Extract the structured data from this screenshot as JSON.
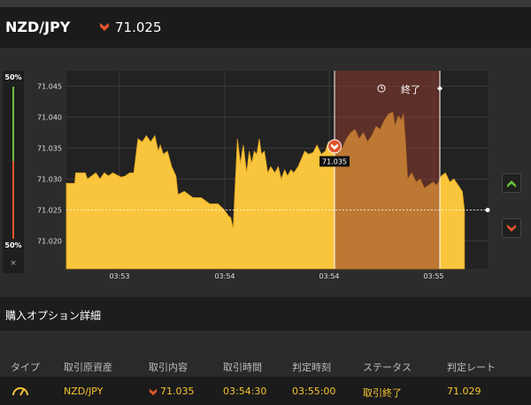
{
  "header": {
    "pair": "NZD/JPY",
    "rate": "71.025",
    "rate_direction_icon": "down-arrow-icon"
  },
  "gauge": {
    "top_label": "50%",
    "bottom_label": "50%",
    "close_glyph": "×"
  },
  "chart_data": {
    "type": "area",
    "yticks": [
      "71.045",
      "71.040",
      "71.035",
      "71.030",
      "71.025",
      "71.020"
    ],
    "ylim": [
      71.0155,
      71.0475
    ],
    "xticks": [
      "03:53",
      "03:54",
      "03:54",
      "03:55"
    ],
    "series": [
      {
        "color": "#f9c53c",
        "points": [
          [
            0,
            71.0293
          ],
          [
            2,
            71.0293
          ],
          [
            2.2,
            71.031
          ],
          [
            4.5,
            71.031
          ],
          [
            5,
            71.03
          ],
          [
            6,
            71.0305
          ],
          [
            7,
            71.031
          ],
          [
            8,
            71.03
          ],
          [
            9,
            71.031
          ],
          [
            10,
            71.0305
          ],
          [
            11,
            71.031
          ],
          [
            13,
            71.0303
          ],
          [
            14,
            71.0305
          ],
          [
            15,
            71.031
          ],
          [
            16,
            71.031
          ],
          [
            17,
            71.0365
          ],
          [
            18,
            71.036
          ],
          [
            19,
            71.037
          ],
          [
            20,
            71.036
          ],
          [
            21,
            71.037
          ],
          [
            21.8,
            71.0345
          ],
          [
            22.3,
            71.0355
          ],
          [
            23,
            71.034
          ],
          [
            24,
            71.0345
          ],
          [
            25,
            71.032
          ],
          [
            26,
            71.0305
          ],
          [
            26.5,
            71.0275
          ],
          [
            28,
            71.028
          ],
          [
            30,
            71.027
          ],
          [
            32,
            71.027
          ],
          [
            34,
            71.026
          ],
          [
            36,
            71.026
          ],
          [
            37.5,
            71.025
          ],
          [
            38.5,
            71.024
          ],
          [
            39,
            71.0238
          ],
          [
            39.6,
            71.022
          ],
          [
            40,
            71.028
          ],
          [
            40.6,
            71.0365
          ],
          [
            41.3,
            71.0325
          ],
          [
            42,
            71.0355
          ],
          [
            42.8,
            71.031
          ],
          [
            43.4,
            71.0345
          ],
          [
            44,
            71.0325
          ],
          [
            44.6,
            71.0345
          ],
          [
            45.2,
            71.034
          ],
          [
            45.8,
            71.0365
          ],
          [
            46.3,
            71.034
          ],
          [
            47,
            71.0345
          ],
          [
            47.8,
            71.031
          ],
          [
            48.5,
            71.032
          ],
          [
            49.5,
            71.031
          ],
          [
            50.3,
            71.032
          ],
          [
            51,
            71.03
          ],
          [
            51.8,
            71.0315
          ],
          [
            52.5,
            71.0305
          ],
          [
            53.3,
            71.0315
          ],
          [
            54,
            71.031
          ],
          [
            55,
            71.032
          ],
          [
            56.6,
            71.0345
          ],
          [
            57.5,
            71.034
          ],
          [
            58.6,
            71.0343
          ],
          [
            59.5,
            71.0355
          ],
          [
            60.5,
            71.034
          ],
          [
            61.5,
            71.0345
          ],
          [
            62.2,
            71.036
          ],
          [
            63.5,
            71.036
          ],
          [
            64.5,
            71.0345
          ],
          [
            65.5,
            71.035
          ],
          [
            66.5,
            71.0365
          ],
          [
            67.5,
            71.0375
          ],
          [
            68.5,
            71.038
          ],
          [
            69.5,
            71.0365
          ],
          [
            70.5,
            71.0375
          ],
          [
            71.5,
            71.036
          ],
          [
            72.5,
            71.037
          ],
          [
            73.5,
            71.0385
          ],
          [
            74.5,
            71.038
          ],
          [
            75.5,
            71.0395
          ],
          [
            76.5,
            71.0405
          ],
          [
            77.5,
            71.0408
          ],
          [
            78,
            71.0385
          ],
          [
            78.8,
            71.0402
          ],
          [
            79.5,
            71.0395
          ],
          [
            80,
            71.0405
          ],
          [
            80.5,
            71.036
          ],
          [
            81,
            71.03
          ],
          [
            82,
            71.031
          ],
          [
            83,
            71.0295
          ],
          [
            84,
            71.03
          ],
          [
            85,
            71.0285
          ],
          [
            86,
            71.029
          ],
          [
            87,
            71.0295
          ],
          [
            88,
            71.029
          ],
          [
            89,
            71.0305
          ],
          [
            90,
            71.031
          ],
          [
            91,
            71.0295
          ],
          [
            92,
            71.03
          ],
          [
            93,
            71.029
          ],
          [
            94,
            71.028
          ],
          [
            94.5,
            71.025
          ]
        ]
      }
    ],
    "current_price": 71.025,
    "entry_price": 71.035,
    "entry_label": "71.035",
    "end_label": "終了"
  },
  "section": {
    "title": "購入オプション詳細"
  },
  "table": {
    "columns": [
      "タイプ",
      "取引原資産",
      "取引内容",
      "取引時間",
      "判定時刻",
      "ステータス",
      "判定レート"
    ],
    "row": {
      "type_icon": "gauge-icon",
      "asset": "NZD/JPY",
      "direction_icon": "down-arrow-icon",
      "content": "71.035",
      "trade_time": "03:54:30",
      "judge_time": "03:55:00",
      "status": "取引終了",
      "judge_rate": "71.029"
    }
  },
  "colors": {
    "area": "#f9c53c",
    "down": "#e0552d",
    "up": "#6bbf3a",
    "end_zone": "#8c3a2e",
    "accent_text": "#f5c431"
  }
}
